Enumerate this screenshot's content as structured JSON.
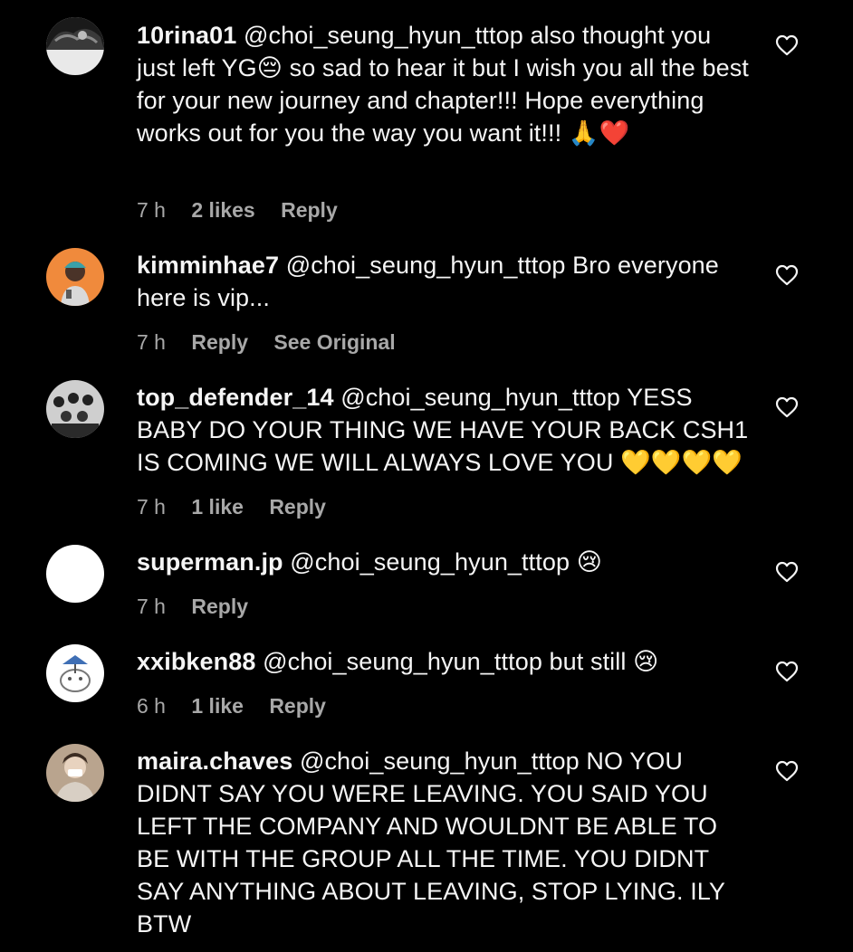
{
  "comments": [
    {
      "username": "10rina01",
      "text": "@choi_seung_hyun_tttop also thought you just left YG😔 so sad to hear it but I wish you all the best for your new journey and chapter!!! Hope everything works out for you the way you want it!!! 🙏❤️",
      "time": "7 h",
      "likes": "2 likes",
      "reply": "Reply",
      "extra": ""
    },
    {
      "username": "kimminhae7",
      "text": "@choi_seung_hyun_tttop Bro everyone here is vip...",
      "time": "7 h",
      "likes": "",
      "reply": "Reply",
      "extra": "See Original"
    },
    {
      "username": "top_defender_14",
      "text": "@choi_seung_hyun_tttop YESS BABY DO YOUR THING WE HAVE YOUR BACK CSH1 IS COMING WE WILL ALWAYS LOVE YOU 💛💛💛💛",
      "time": "7 h",
      "likes": "1 like",
      "reply": "Reply",
      "extra": ""
    },
    {
      "username": "superman.jp",
      "text": "@choi_seung_hyun_tttop 😢",
      "time": "7 h",
      "likes": "",
      "reply": "Reply",
      "extra": ""
    },
    {
      "username": "xxibken88",
      "text": "@choi_seung_hyun_tttop but still 😢",
      "time": "6 h",
      "likes": "1 like",
      "reply": "Reply",
      "extra": ""
    },
    {
      "username": "maira.chaves",
      "text": "@choi_seung_hyun_tttop NO YOU DIDNT SAY YOU WERE LEAVING. YOU SAID YOU LEFT THE COMPANY AND WOULDNT BE ABLE TO BE WITH THE GROUP ALL THE TIME. YOU DIDNT SAY ANYTHING ABOUT LEAVING, STOP LYING. ILY BTW",
      "time": "",
      "likes": "",
      "reply": "",
      "extra": ""
    }
  ],
  "icons": {
    "like": "heart-outline-icon"
  },
  "colors": {
    "background": "#000000",
    "text": "#f5f5f5",
    "meta": "#a8a8a8"
  }
}
